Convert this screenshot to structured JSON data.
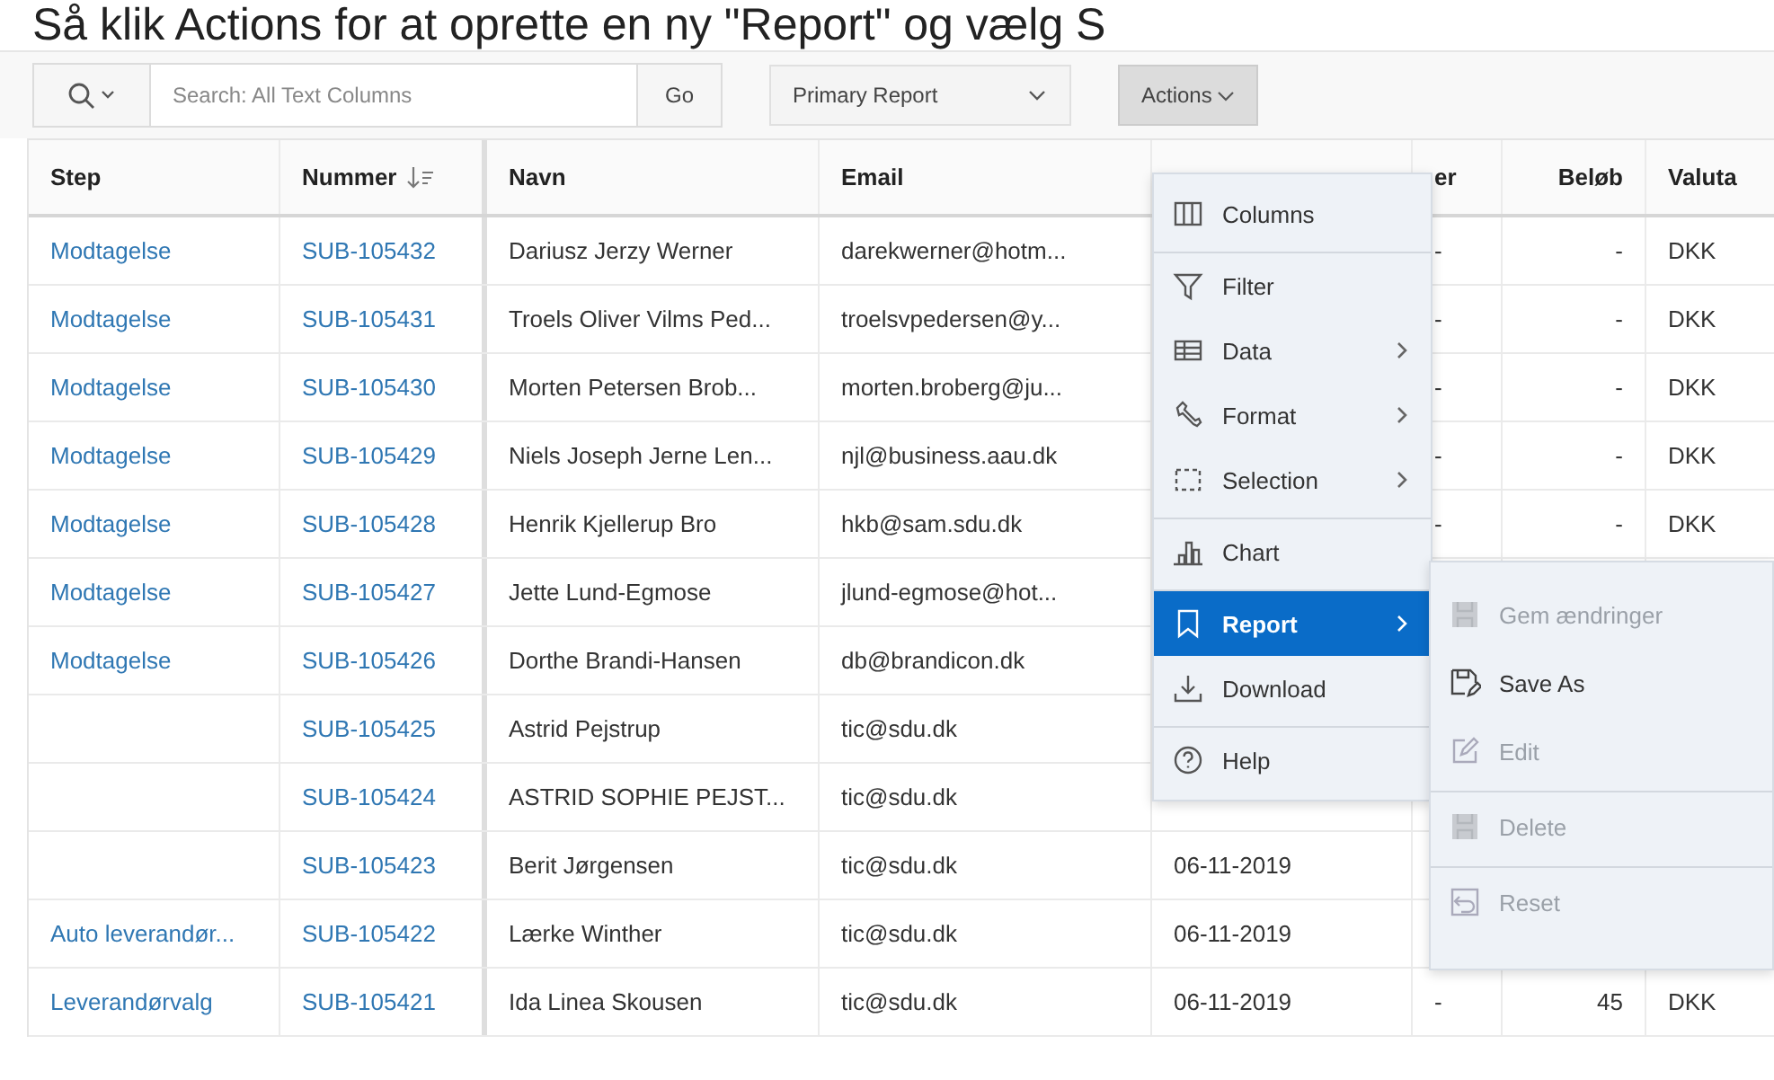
{
  "caption": "Så klik Actions for at oprette en ny \"Report\" og vælg S",
  "toolbar": {
    "search": {
      "placeholder": "Search: All Text Columns"
    },
    "go_button": "Go",
    "report_select": "Primary Report",
    "actions_button": {
      "label": "Actions",
      "pressed": true
    }
  },
  "table": {
    "columns": [
      {
        "label": "Step",
        "sorted": false
      },
      {
        "label": "Nummer",
        "sorted": true
      },
      {
        "label": "Navn",
        "sorted": false
      },
      {
        "label": "Email",
        "sorted": false
      },
      {
        "sorted": false
      },
      {
        "label": "er",
        "sorted": false
      },
      {
        "label": "Beløb",
        "sorted": false
      },
      {
        "label": "Valuta",
        "sorted": false
      }
    ],
    "rows": [
      {
        "step": "Modtagelse",
        "nummer": "SUB-105432",
        "navn": "Dariusz Jerzy Werner",
        "email": "darekwerner@hotm...",
        "timer": "-",
        "belob": "-",
        "valuta": "DKK"
      },
      {
        "step": "Modtagelse",
        "nummer": "SUB-105431",
        "navn": "Troels Oliver Vilms Ped...",
        "email": "troelsvpedersen@y...",
        "timer": "-",
        "belob": "-",
        "valuta": "DKK"
      },
      {
        "step": "Modtagelse",
        "nummer": "SUB-105430",
        "navn": "Morten Petersen Brob...",
        "email": "morten.broberg@ju...",
        "timer": "-",
        "belob": "-",
        "valuta": "DKK"
      },
      {
        "step": "Modtagelse",
        "nummer": "SUB-105429",
        "navn": "Niels Joseph Jerne Len...",
        "email": "njl@business.aau.dk",
        "timer": "-",
        "belob": "-",
        "valuta": "DKK"
      },
      {
        "step": "Modtagelse",
        "nummer": "SUB-105428",
        "navn": "Henrik Kjellerup Bro",
        "email": "hkb@sam.sdu.dk",
        "timer": "-",
        "belob": "-",
        "valuta": "DKK"
      },
      {
        "step": "Modtagelse",
        "nummer": "SUB-105427",
        "navn": "Jette Lund-Egmose",
        "email": "jlund-egmose@hot..."
      },
      {
        "step": "Modtagelse",
        "nummer": "SUB-105426",
        "navn": "Dorthe Brandi-Hansen",
        "email": "db@brandicon.dk"
      },
      {
        "nummer": "SUB-105425",
        "navn": "Astrid Pejstrup",
        "email": "tic@sdu.dk"
      },
      {
        "nummer": "SUB-105424",
        "navn": "ASTRID SOPHIE PEJST...",
        "email": "tic@sdu.dk"
      },
      {
        "nummer": "SUB-105423",
        "navn": "Berit Jørgensen",
        "email": "tic@sdu.dk",
        "date": "06-11-2019"
      },
      {
        "step": "Auto leverandør...",
        "nummer": "SUB-105422",
        "navn": "Lærke Winther",
        "email": "tic@sdu.dk",
        "date": "06-11-2019"
      },
      {
        "step": "Leverandørvalg",
        "nummer": "SUB-105421",
        "navn": "Ida Linea Skousen",
        "email": "tic@sdu.dk",
        "date": "06-11-2019",
        "timer": "-",
        "belob": "45",
        "valuta": "DKK"
      }
    ]
  },
  "actions_menu": {
    "items": [
      {
        "label": "Columns",
        "selected": false,
        "submenu": false,
        "divider_before": false
      },
      {
        "label": "Filter",
        "selected": false,
        "submenu": false,
        "divider_before": true
      },
      {
        "label": "Data",
        "selected": false,
        "submenu": true,
        "divider_before": false
      },
      {
        "label": "Format",
        "selected": false,
        "submenu": true,
        "divider_before": false
      },
      {
        "label": "Selection",
        "selected": false,
        "submenu": true,
        "divider_before": false
      },
      {
        "label": "Chart",
        "selected": false,
        "submenu": false,
        "divider_before": true
      },
      {
        "label": "Report",
        "selected": true,
        "submenu": true,
        "divider_before": true
      },
      {
        "label": "Download",
        "selected": false,
        "submenu": false,
        "divider_before": false
      },
      {
        "label": "Help",
        "selected": false,
        "submenu": false,
        "divider_before": true
      }
    ]
  },
  "report_submenu": {
    "items": [
      {
        "label": "Gem ændringer",
        "disabled": true,
        "divider_before": false
      },
      {
        "label": "Save As",
        "disabled": false,
        "divider_before": false
      },
      {
        "label": "Edit",
        "disabled": true,
        "divider_before": false
      },
      {
        "label": "Delete",
        "disabled": true,
        "divider_before": true
      },
      {
        "label": "Reset",
        "disabled": true,
        "divider_before": true
      }
    ]
  }
}
